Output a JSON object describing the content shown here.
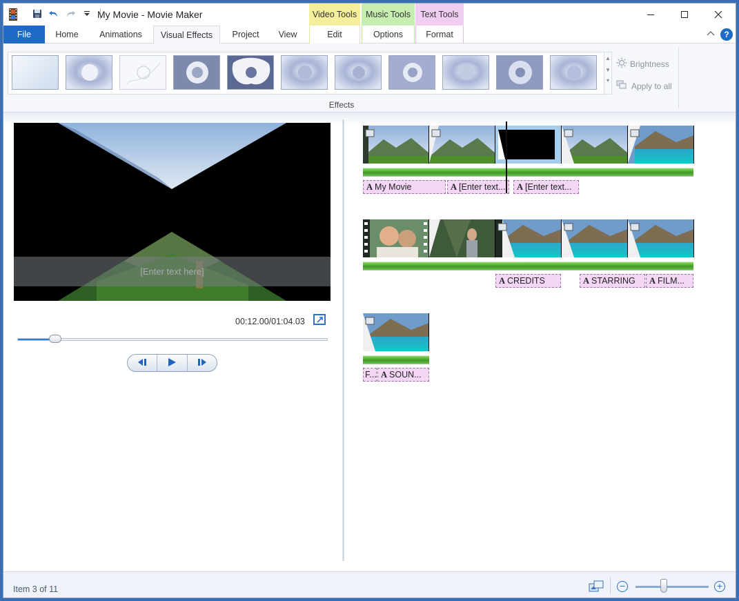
{
  "titlebar": {
    "title": "My Movie - Movie Maker",
    "context_tabs": {
      "video": "Video Tools",
      "music": "Music Tools",
      "text": "Text Tools"
    }
  },
  "tabs": {
    "file": "File",
    "home": "Home",
    "animations": "Animations",
    "visual_effects": "Visual Effects",
    "project": "Project",
    "view": "View",
    "edit": "Edit",
    "options": "Options",
    "format": "Format"
  },
  "ribbon": {
    "brightness": "Brightness",
    "apply_to_all": "Apply to all",
    "group_label": "Effects"
  },
  "preview": {
    "caption_placeholder": "[Enter text here]",
    "timecode": "00:12.00/01:04.03",
    "seek_fraction": 0.12
  },
  "timeline": {
    "row1_captions": [
      "My Movie",
      "[Enter text...",
      "[Enter text..."
    ],
    "row2_captions": [
      "CREDITS",
      "STARRING",
      "FILM..."
    ],
    "row3_captions": [
      "F...",
      "SOUN..."
    ]
  },
  "status": {
    "item_text": "Item 3 of 11"
  },
  "colors": {
    "accent": "#1e6bc7",
    "video_tools": "#f3ef9a",
    "music_tools": "#c7eeb1",
    "text_tools": "#f1cdf2",
    "caption_bg": "#f4d6f5"
  }
}
